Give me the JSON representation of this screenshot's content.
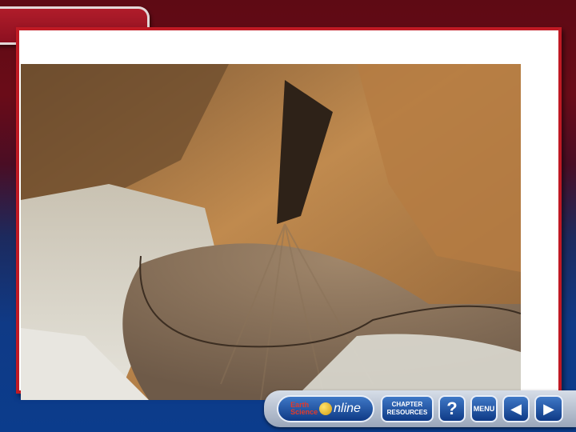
{
  "nav": {
    "logo_earth": "Earth",
    "logo_science": "Science",
    "logo_online": "nline",
    "chapter_line1": "CHAPTER",
    "chapter_line2": "RESOURCES",
    "help_label": "?",
    "menu_label": "MENU",
    "prev_symbol": "◀",
    "next_symbol": "▶"
  },
  "colors": {
    "title_tab": "#a0182a",
    "panel_border": "#c01a24",
    "button_blue": "#0f3a86"
  }
}
